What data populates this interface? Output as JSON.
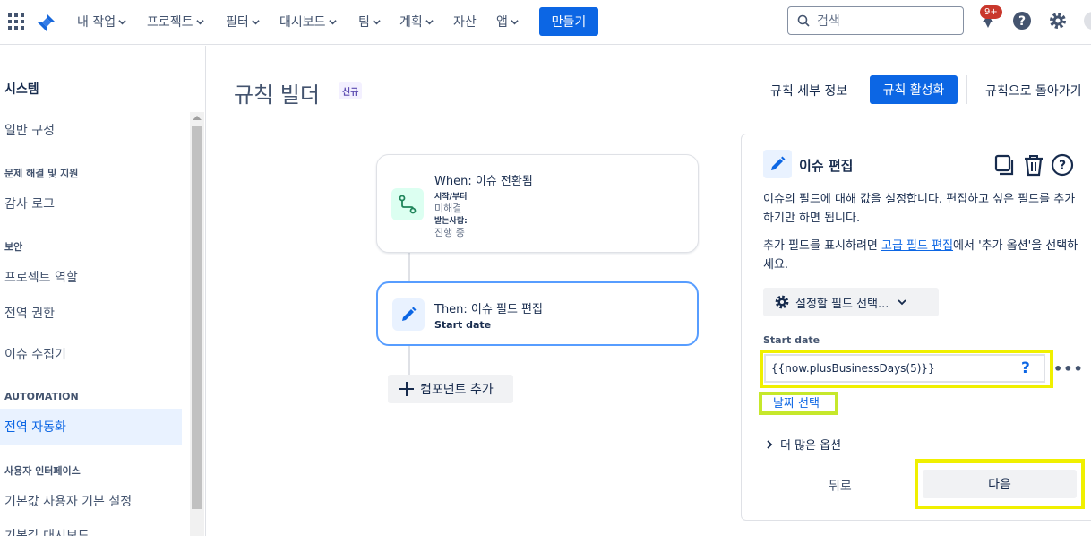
{
  "topnav": {
    "items": [
      "내 작업",
      "프로젝트",
      "필터",
      "대시보드",
      "팀",
      "계획",
      "자산",
      "앱"
    ],
    "create_label": "만들기",
    "search_placeholder": "검색",
    "notification_count": "9+",
    "icons": [
      "app-switcher-icon",
      "jira-logo-icon",
      "search-icon",
      "notification-icon",
      "help-icon",
      "gear-icon",
      "profile-icon"
    ]
  },
  "sidebar": {
    "title": "시스템",
    "general": "일반 구성",
    "sections": {
      "troubleshoot": "문제 해결 및 지원",
      "security": "보안",
      "automation": "AUTOMATION",
      "ui": "사용자 인터페이스"
    },
    "items": {
      "audit_log": "감사 로그",
      "project_roles": "프로젝트 역할",
      "global_perms": "전역 권한",
      "issue_collector": "이슈 수집기",
      "global_automation": "전역 자동화",
      "default_user_prefs": "기본값 사용자 기본 설정",
      "default_dashboard": "기본값 대시보드"
    }
  },
  "header": {
    "title": "규칙 빌더",
    "lozenge": "신규",
    "rule_details": "규칙 세부 정보",
    "activate": "규칙 활성화",
    "back_to_rules": "규칙으로 돌아가기"
  },
  "canvas": {
    "trigger": {
      "title": "When: 이슈 전환됨",
      "from_label": "시작/부터",
      "from_value": "미해결",
      "to_label": "받는사람:",
      "to_value": "진행 중"
    },
    "action": {
      "title": "Then: 이슈 필드 편집",
      "subtitle": "Start date"
    },
    "add_component": "컴포넌트 추가"
  },
  "panel": {
    "title": "이슈 편집",
    "desc1": "이슈의 필드에 대해 값을 설정합니다. 편집하고 싶은 필드를 추가하기만 하면 됩니다.",
    "desc2_before": "추가 필드를 표시하려면 ",
    "desc2_link": "고급 필드 편집",
    "desc2_after": "에서 '추가 옵션'을 선택하세요.",
    "field_select": "설정할 필드 선택...",
    "field_label": "Start date",
    "field_value": "{{now.plusBusinessDays(5)}}",
    "help_glyph": "?",
    "more_glyph": "•••",
    "date_picker": "날짜 선택",
    "more_options": "더 많은 옵션",
    "back": "뒤로",
    "next": "다음",
    "colors": {
      "highlight_yellow": "#F0F000",
      "highlight_green": "#C6E82B",
      "brand_blue": "#0C66E4"
    }
  }
}
